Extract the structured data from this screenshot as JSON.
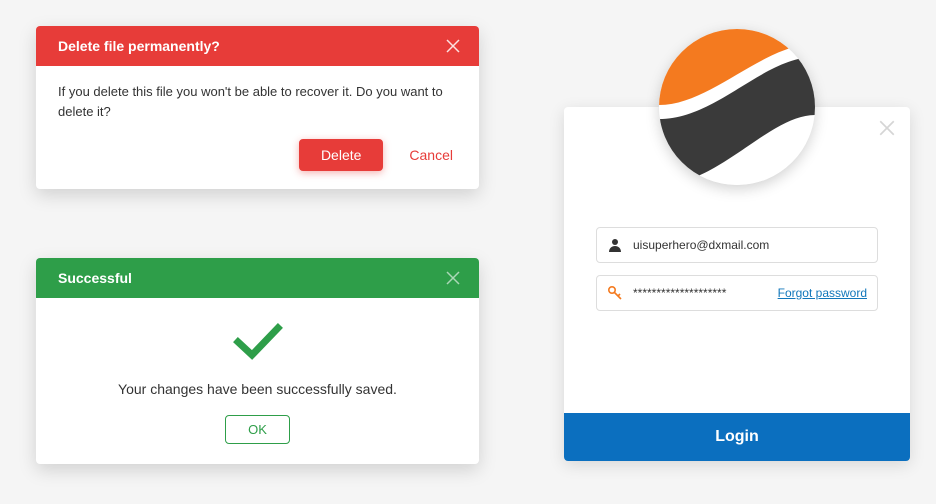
{
  "delete_dialog": {
    "title": "Delete file permanently?",
    "message": "If you delete this file you won't be able to recover it. Do you want to delete it?",
    "delete_label": "Delete",
    "cancel_label": "Cancel"
  },
  "success_dialog": {
    "title": "Successful",
    "message": "Your changes have been successfully saved.",
    "ok_label": "OK"
  },
  "login": {
    "email_value": "uisuperhero@dxmail.com",
    "password_value": "********************",
    "forgot_label": "Forgot password",
    "login_label": "Login"
  },
  "colors": {
    "danger": "#e73c39",
    "success": "#2e9e49",
    "primary": "#0b6fbf",
    "logo_orange": "#f47a1f",
    "logo_dark": "#3a3a3a"
  }
}
